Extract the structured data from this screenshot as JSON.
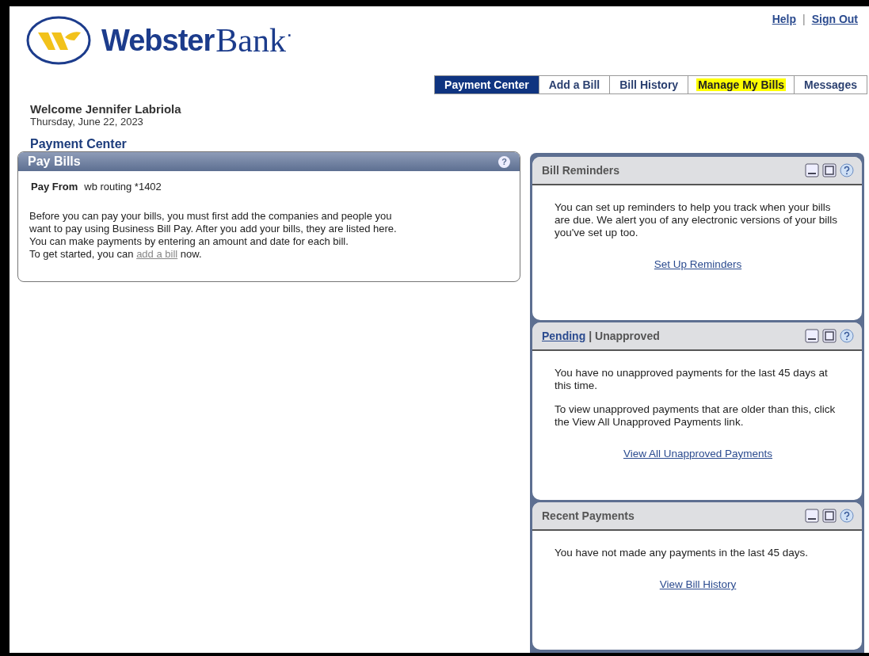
{
  "logo": {
    "bold": "Webster",
    "regular": "Bank",
    "mark": "·"
  },
  "top_links": [
    "Help",
    "Sign Out"
  ],
  "top_links_separator": "|",
  "tabs": [
    {
      "label": "Payment Center",
      "selected": true,
      "highlighted": false
    },
    {
      "label": "Add a Bill",
      "selected": false,
      "highlighted": false
    },
    {
      "label": "Bill History",
      "selected": false,
      "highlighted": false
    },
    {
      "label": "Manage My Bills",
      "selected": false,
      "highlighted": true
    },
    {
      "label": "Messages",
      "selected": false,
      "highlighted": false
    }
  ],
  "welcome": "Welcome Jennifer Labriola",
  "date": "Thursday, June 22, 2023",
  "page_title": "Payment Center",
  "pay_bills": {
    "title": "Pay Bills",
    "help": "?",
    "pay_from_label": "Pay From",
    "pay_from_value": "wb routing *1402",
    "lines": [
      "Before you can pay your bills, you must first add the companies and people you",
      "want to pay using Business Bill Pay. After you add your bills, they are listed here.",
      "You can make payments by entering an amount and date for each bill."
    ],
    "last_line": {
      "before": "To get started, you can ",
      "link": "add a bill",
      "after": " now."
    }
  },
  "widgets": [
    {
      "header": [
        {
          "kind": "text",
          "text": "Bill Reminders"
        }
      ],
      "paragraphs": [
        "You can set up reminders to help you track when your bills are due. We alert you of any electronic versions of your bills you've set up too."
      ],
      "link": "Set Up Reminders"
    },
    {
      "header": [
        {
          "kind": "link",
          "text": "Pending"
        },
        {
          "kind": "text",
          "text": "| Unapproved"
        }
      ],
      "paragraphs": [
        "You have no unapproved payments for the last 45 days at this time.",
        "To view unapproved payments that are older than this, click the View All Unapproved Payments link."
      ],
      "link": "View All Unapproved Payments"
    },
    {
      "header": [
        {
          "kind": "text",
          "text": "Recent Payments"
        }
      ],
      "paragraphs": [
        "You have not made any payments in the last 45 days."
      ],
      "link": "View Bill History"
    }
  ]
}
